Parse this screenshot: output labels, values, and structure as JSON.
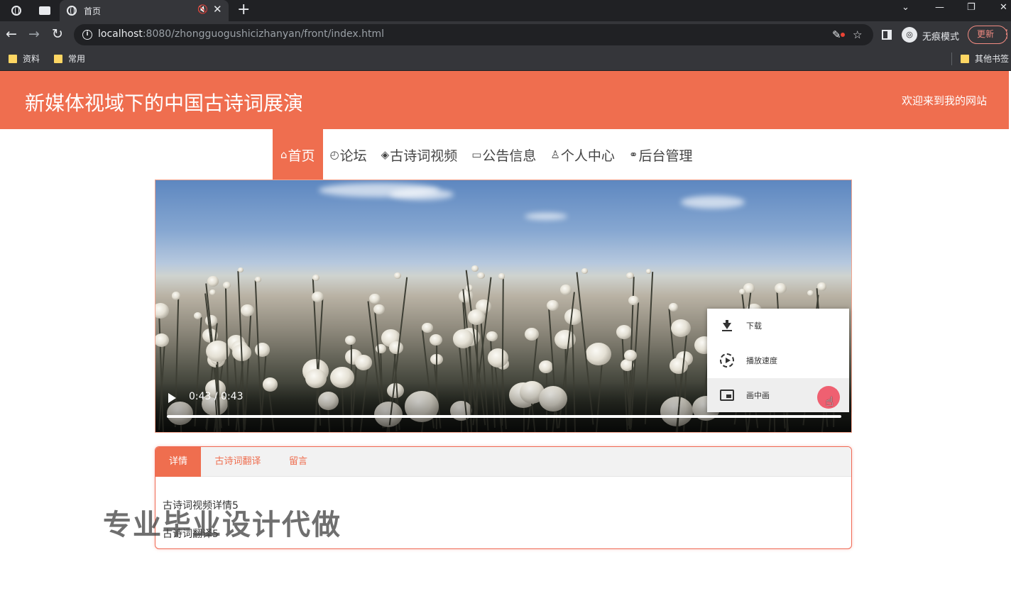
{
  "browser": {
    "tab_title": "首页",
    "url_host": "localhost",
    "url_rest": ":8080/zhongguogushicizhanyan/front/index.html",
    "incognito_label": "无痕模式",
    "update_label": "更新",
    "bookmarks": [
      "资料",
      "常用"
    ],
    "other_bookmarks": "其他书签"
  },
  "site": {
    "title": "新媒体视域下的中国古诗词展演",
    "welcome": "欢迎来到我的网站"
  },
  "nav": [
    {
      "glyph": "⌂",
      "label": "首页",
      "active": true
    },
    {
      "glyph": "◴",
      "label": "论坛",
      "active": false
    },
    {
      "glyph": "◈",
      "label": "古诗词视频",
      "active": false
    },
    {
      "glyph": "▭",
      "label": "公告信息",
      "active": false
    },
    {
      "glyph": "♙",
      "label": "个人中心",
      "active": false
    },
    {
      "glyph": "⚭",
      "label": "后台管理",
      "active": false
    }
  ],
  "video": {
    "time": "0:43 / 0:43",
    "progress": 1.0,
    "menu": {
      "download": "下载",
      "speed": "播放速度",
      "pip": "画中画"
    }
  },
  "details": {
    "tabs": [
      "详情",
      "古诗词翻译",
      "留言"
    ],
    "line1": "古诗词视频详情5",
    "line2": "古诗词翻译5"
  },
  "watermark": "专业毕业设计代做"
}
